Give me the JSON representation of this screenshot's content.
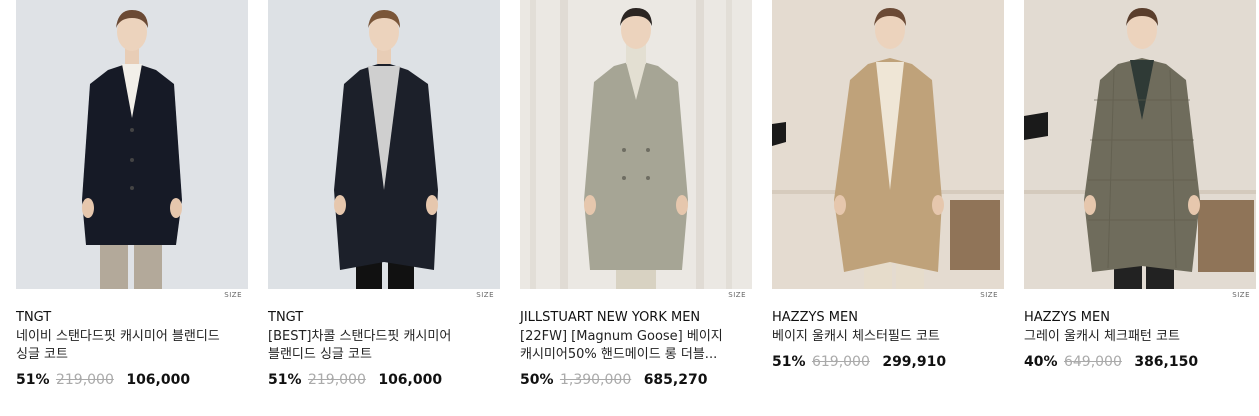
{
  "size_tag": "SIZE",
  "products": [
    {
      "brand": "TNGT",
      "name": "네이비 스탠다드핏 캐시미어 블랜디드 싱글 코트",
      "discount": "51%",
      "original_price": "219,000",
      "sale_price": "106,000",
      "background_color": "#dfe2e6",
      "coat_color": "#161a26",
      "inner_color": "#f2efe9",
      "pants_color": "#b3a99a"
    },
    {
      "brand": "TNGT",
      "name": "[BEST]차콜 스탠다드핏 캐시미어 블랜디드 싱글 코트",
      "discount": "51%",
      "original_price": "219,000",
      "sale_price": "106,000",
      "background_color": "#dde1e5",
      "coat_color": "#1c202a",
      "inner_color": "#cfcfcf",
      "pants_color": "#111111"
    },
    {
      "brand": "JILLSTUART NEW YORK MEN",
      "name": "[22FW] [Magnum Goose] 베이지 캐시미어50% 핸드메이드 롱 더블...",
      "discount": "50%",
      "original_price": "1,390,000",
      "sale_price": "685,270",
      "background_color": "#ebe8e3",
      "coat_color": "#a6a595",
      "inner_color": "#e3dfd2",
      "pants_color": "#d8d2c2"
    },
    {
      "brand": "HAZZYS MEN",
      "name": "베이지 울캐시 체스터필드 코트",
      "discount": "51%",
      "original_price": "619,000",
      "sale_price": "299,910",
      "background_color": "#e4dbd0",
      "coat_color": "#bfa27a",
      "inner_color": "#efe6d6",
      "pants_color": "#e6dccb"
    },
    {
      "brand": "HAZZYS MEN",
      "name": "그레이 울캐시 체크패턴 코트",
      "discount": "40%",
      "original_price": "649,000",
      "sale_price": "386,150",
      "background_color": "#e2dbd2",
      "coat_color": "#6f6c5c",
      "inner_color": "#2f3a36",
      "pants_color": "#222222"
    }
  ]
}
